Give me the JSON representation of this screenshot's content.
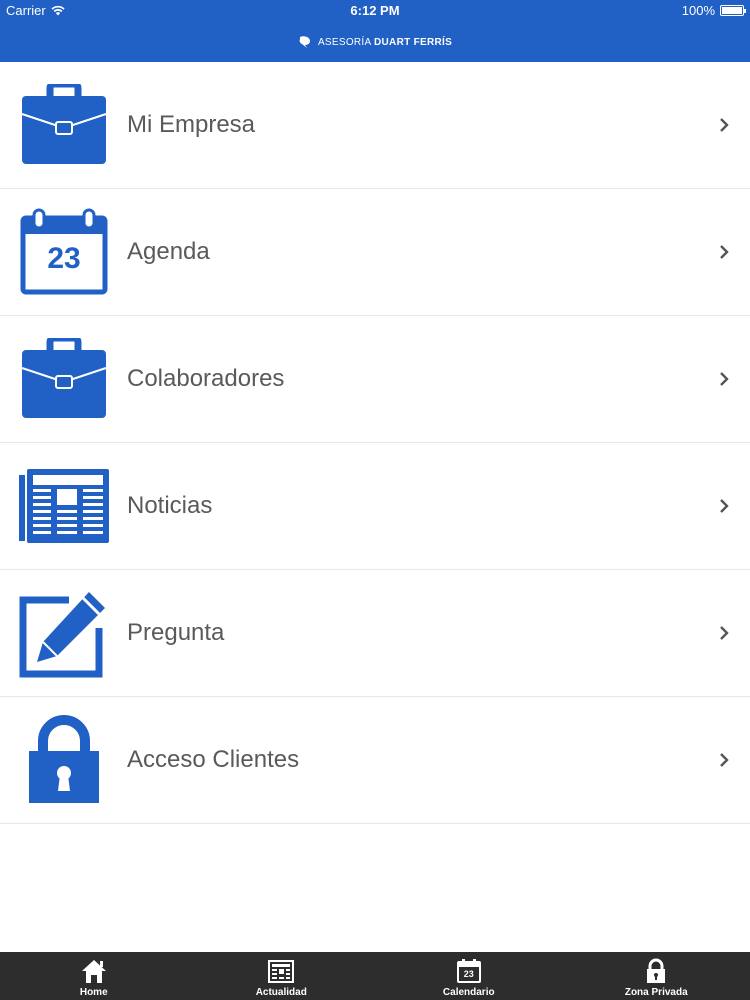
{
  "status_bar": {
    "carrier": "Carrier",
    "time": "6:12 PM",
    "battery": "100%"
  },
  "header": {
    "brand_light": "ASESORÍA",
    "brand_bold": "DUART FERRÍS"
  },
  "menu": {
    "items": [
      {
        "label": "Mi Empresa",
        "icon": "briefcase-icon"
      },
      {
        "label": "Agenda",
        "icon": "calendar-icon",
        "day": "23"
      },
      {
        "label": "Colaboradores",
        "icon": "briefcase-icon"
      },
      {
        "label": "Noticias",
        "icon": "newspaper-icon"
      },
      {
        "label": "Pregunta",
        "icon": "edit-icon"
      },
      {
        "label": "Acceso Clientes",
        "icon": "lock-icon"
      }
    ]
  },
  "tab_bar": {
    "tabs": [
      {
        "label": "Home",
        "icon": "home-icon"
      },
      {
        "label": "Actualidad",
        "icon": "newspaper-icon"
      },
      {
        "label": "Calendario",
        "icon": "calendar-icon",
        "day": "23"
      },
      {
        "label": "Zona Privada",
        "icon": "lock-icon"
      }
    ]
  },
  "colors": {
    "primary": "#2160c4",
    "tab_bar": "#2d2d2d",
    "label_text": "#5a5a5a",
    "divider": "#e8e8e8"
  }
}
